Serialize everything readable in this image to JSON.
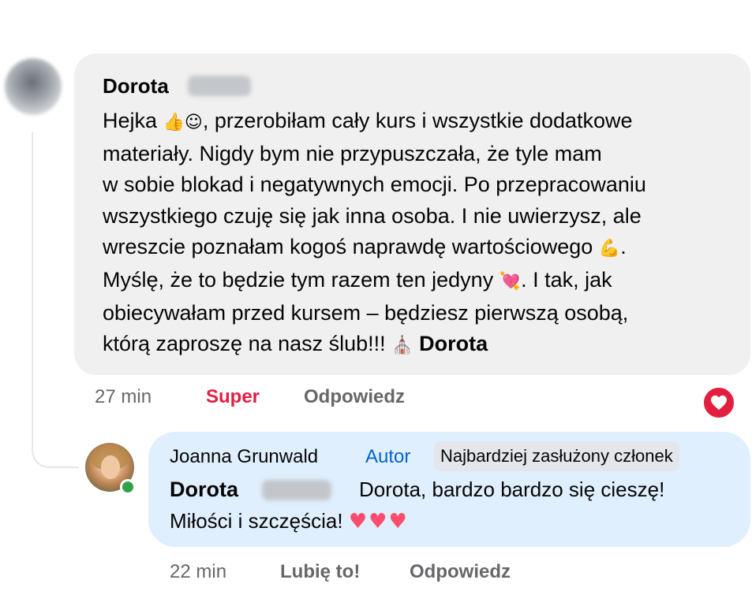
{
  "comment": {
    "author_first_name": "Dorota",
    "text_lines": [
      {
        "before": "Hejka ",
        "emoji": "👍☺",
        "after": ", przerobiłam cały kurs i wszystkie dodatkowe"
      },
      {
        "before": "materiały. Nigdy bym nie przypuszczała, że tyle mam",
        "emoji": "",
        "after": ""
      },
      {
        "before": "w sobie blokad i negatywnych emocji. Po przepracowaniu",
        "emoji": "",
        "after": ""
      },
      {
        "before": "wszystkiego czuję się jak inna osoba. I nie uwierzysz, ale",
        "emoji": "",
        "after": ""
      },
      {
        "before": "wreszcie poznałam kogoś naprawdę wartościowego ",
        "emoji": "💪",
        "after": "."
      },
      {
        "before": "Myślę, że to będzie tym razem ten jedyny ",
        "emoji": "💘",
        "after": ". I tak, jak"
      },
      {
        "before": "obiecywałam przed kursem – będziesz pierwszą osobą,",
        "emoji": "",
        "after": ""
      },
      {
        "before": "którą zaproszę na nasz ślub!!! ",
        "emoji": "⛪",
        "after": ""
      }
    ],
    "signature": "Dorota",
    "time": "27 min",
    "reaction_label": "Super",
    "reply_label": "Odpowiedz",
    "reaction_icon": "heart-icon",
    "reaction_color": "#e41e3f"
  },
  "reply": {
    "author_name": "Joanna Grunwald",
    "author_badge": "Autor",
    "member_badge": "Najbardziej zasłużony członek",
    "mention_first_name": "Dorota",
    "text_line1": "Dorota, bardzo bardzo się cieszę!",
    "text_line2": "Miłości i szczęścia! ",
    "hearts": "♥♥♥",
    "time": "22 min",
    "like_label": "Lubię to!",
    "reply_label": "Odpowiedz"
  },
  "colors": {
    "bubble_gray": "#f0f0f0",
    "bubble_blue": "#e0effd",
    "link_blue": "#0064d1",
    "muted": "#65676b",
    "online": "#31a24c"
  }
}
